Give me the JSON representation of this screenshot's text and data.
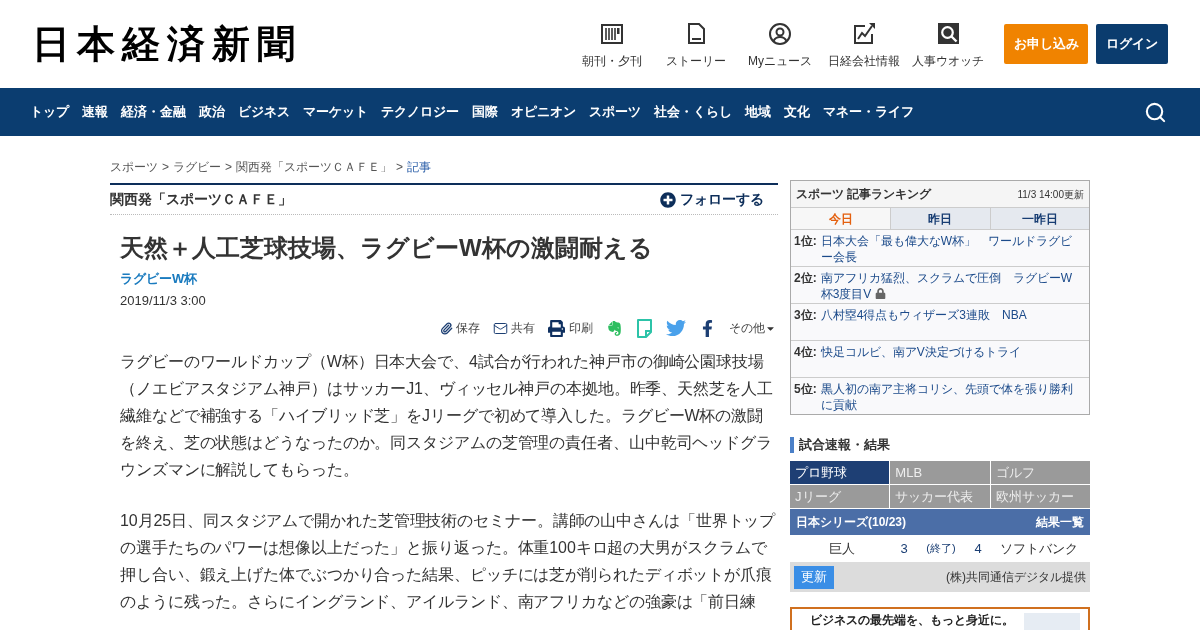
{
  "header": {
    "logo": "日本経済新聞",
    "links": [
      {
        "kind": "paper",
        "label": "朝刊・夕刊"
      },
      {
        "kind": "story",
        "label": "ストーリー"
      },
      {
        "kind": "user",
        "label": "Myニュース"
      },
      {
        "kind": "chart",
        "label": "日経会社情報"
      },
      {
        "kind": "search",
        "label": "人事ウオッチ"
      }
    ],
    "buttons": [
      {
        "kind": "subscribe",
        "label": "お申し込み"
      },
      {
        "kind": "login",
        "label": "ログイン"
      }
    ]
  },
  "nav": {
    "items": [
      "トップ",
      "速報",
      "経済・金融",
      "政治",
      "ビジネス",
      "マーケット",
      "テクノロジー",
      "国際",
      "オピニオン",
      "スポーツ",
      "社会・くらし",
      "地域",
      "文化",
      "マネー・ライフ"
    ]
  },
  "breadcrumb": {
    "separator": ">",
    "items": [
      {
        "label": "スポーツ",
        "current": false
      },
      {
        "label": "ラグビー",
        "current": false
      },
      {
        "label": "関西発「スポーツＣＡＦＥ」",
        "current": false
      },
      {
        "label": "記事",
        "current": true
      }
    ]
  },
  "series": {
    "title": "関西発「スポーツＣＡＦＥ」",
    "follow": "フォローする"
  },
  "article": {
    "headline": "天然＋人工芝球技場、ラグビーW杯の激闘耐える",
    "tag": "ラグビーW杯",
    "date": "2019/11/3 3:00",
    "share": [
      {
        "kind": "save",
        "label": "保存"
      },
      {
        "kind": "mail",
        "label": "共有"
      },
      {
        "kind": "print",
        "label": "印刷"
      },
      {
        "kind": "evernote"
      },
      {
        "kind": "note"
      },
      {
        "kind": "twitter"
      },
      {
        "kind": "facebook"
      },
      {
        "kind": "more",
        "label": "その他"
      }
    ],
    "paragraphs": [
      "ラグビーのワールドカップ（W杯）日本大会で、4試合が行われた神戸市の御崎公園球技場（ノエビアスタジアム神戸）はサッカーJ1、ヴィッセル神戸の本拠地。昨季、天然芝を人工繊維などで補強する「ハイブリッド芝」をJリーグで初めて導入した。ラグビーW杯の激闘を終え、芝の状態はどうなったのか。同スタジアムの芝管理の責任者、山中乾司ヘッドグラウンズマンに解説してもらった。",
      "10月25日、同スタジアムで開かれた芝管理技術のセミナー。講師の山中さんは「世界トップの選手たちのパワーは想像以上だった」と振り返った。体重100キロ超の大男がスクラムで押し合い、鍛え上げた体でぶつかり合った結果、ピッチには芝が削られたディボットが爪痕のように残った。さらにイングランド、アイルランド、南アフリカなどの強豪は「前日練"
    ]
  },
  "ranking": {
    "title": "スポーツ 記事ランキング",
    "updated": "11/3 14:00更新",
    "tabs": [
      {
        "label": "今日",
        "selected": true
      },
      {
        "label": "昨日",
        "selected": false
      },
      {
        "label": "一昨日",
        "selected": false
      }
    ],
    "items": [
      {
        "rank": "1位:",
        "title": "日本大会「最も偉大なW杯」　ワールドラグビー会長",
        "locked": false
      },
      {
        "rank": "2位:",
        "title": "南アフリカ猛烈、スクラムで圧倒　ラグビーW杯3度目V",
        "locked": true
      },
      {
        "rank": "3位:",
        "title": "八村塁4得点もウィザーズ3連敗　NBA",
        "locked": false
      },
      {
        "rank": "4位:",
        "title": "快足コルビ、南アV決定づけるトライ",
        "locked": false
      },
      {
        "rank": "5位:",
        "title": "黒人初の南ア主将コリシ、先頭で体を張り勝利に貢献",
        "locked": false
      }
    ]
  },
  "scores": {
    "heading": "試合速報・結果",
    "tabs": [
      {
        "label": "プロ野球",
        "selected": true
      },
      {
        "label": "MLB",
        "selected": false
      },
      {
        "label": "ゴルフ",
        "selected": false
      },
      {
        "label": "Jリーグ",
        "selected": false
      },
      {
        "label": "サッカー代表",
        "selected": false
      },
      {
        "label": "欧州サッカー",
        "selected": false
      }
    ],
    "series": "日本シリーズ(10/23)",
    "results_link": "結果一覧",
    "games": [
      {
        "home": "巨人",
        "home_score": "3",
        "status": "(終了)",
        "away_score": "4",
        "away": "ソフトバンク"
      }
    ],
    "refresh": "更新",
    "credit": "(株)共同通信デジタル提供"
  },
  "ad": {
    "text": "ビジネスの最先端を、もっと身近に。"
  }
}
